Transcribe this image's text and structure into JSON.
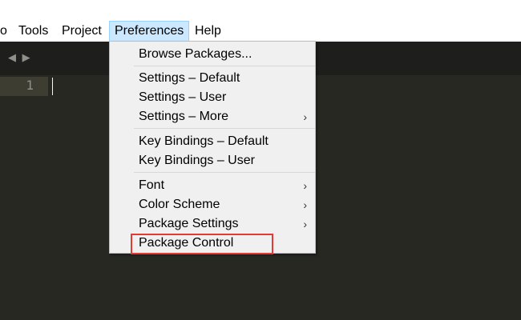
{
  "menubar": {
    "items": [
      {
        "label": "o"
      },
      {
        "label": "Tools"
      },
      {
        "label": "Project"
      },
      {
        "label": "Preferences"
      },
      {
        "label": "Help"
      }
    ]
  },
  "editor": {
    "nav_arrows": "◀ ▶",
    "line_number": "1",
    "background_color": "#272822"
  },
  "preferences_menu": {
    "items": [
      {
        "label": "Browse Packages..."
      },
      {
        "label": "Settings – Default"
      },
      {
        "label": "Settings – User"
      },
      {
        "label": "Settings – More",
        "submenu_arrow": "›"
      },
      {
        "label": "Key Bindings – Default"
      },
      {
        "label": "Key Bindings – User"
      },
      {
        "label": "Font",
        "submenu_arrow": "›"
      },
      {
        "label": "Color Scheme",
        "submenu_arrow": "›"
      },
      {
        "label": "Package Settings",
        "submenu_arrow": "›"
      },
      {
        "label": "Package Control"
      }
    ],
    "highlight_color": "#e53935"
  }
}
